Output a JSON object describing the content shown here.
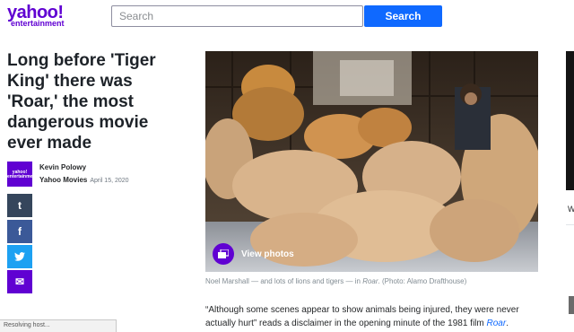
{
  "header": {
    "logo_brand": "yahoo!",
    "logo_sub": "entertainment",
    "search_placeholder": "Search",
    "search_button": "Search"
  },
  "article": {
    "headline": "Long before 'Tiger King' there was 'Roar,' the most dangerous movie ever made",
    "avatar_text": "yahoo! entertainment",
    "author": "Kevin Polowy",
    "source": "Yahoo Movies",
    "date": "April 15, 2020",
    "view_photos": "View photos",
    "caption_pre": "Noel Marshall — and lots of lions and tigers — in ",
    "caption_title": "Roar",
    "caption_post": ". (Photo: Alamo Drafthouse)",
    "para_pre": "“Although some scenes appear to show animals being injured, they were never actually hurt” reads a disclaimer in the opening minute of the 1981 film ",
    "para_link": "Roar",
    "para_post": "."
  },
  "share": {
    "tumblr": "t",
    "facebook": "f",
    "twitter": "t",
    "mail": "✉"
  },
  "status_bar": "Resolving host...",
  "right_rail": {
    "letter": "W"
  },
  "colors": {
    "brand": "#6001d2",
    "search_button": "#0f69ff",
    "tumblr": "#35465c",
    "facebook": "#3b5998",
    "twitter": "#1da1f2"
  }
}
